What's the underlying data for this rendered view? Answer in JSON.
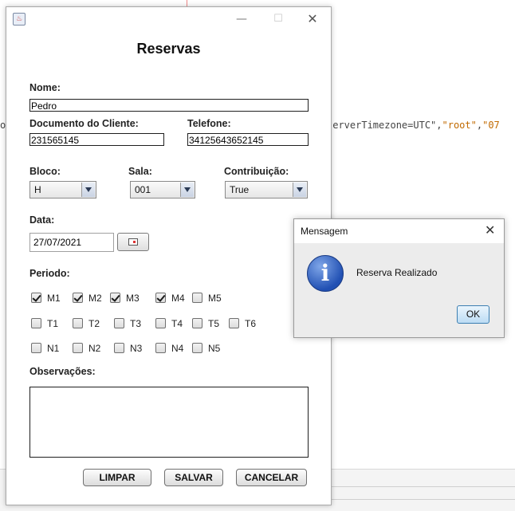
{
  "background": {
    "code_left": "o",
    "code_text_pre": "serverTimezone=UTC\",",
    "code_str1": "\"root\"",
    "code_sep": ",",
    "code_str2": "\"07"
  },
  "window": {
    "title": "",
    "heading": "Reservas",
    "controls": {
      "minimize": "—",
      "maximize": "☐",
      "close": "✕"
    }
  },
  "form": {
    "nome": {
      "label": "Nome:",
      "value": "Pedro"
    },
    "documento": {
      "label": "Documento do Cliente:",
      "value": "231565145"
    },
    "telefone": {
      "label": "Telefone:",
      "value": "34125643652145"
    },
    "bloco": {
      "label": "Bloco:",
      "value": "H"
    },
    "sala": {
      "label": "Sala:",
      "value": "001"
    },
    "contribuicao": {
      "label": "Contribuição:",
      "value": "True"
    },
    "data": {
      "label": "Data:",
      "value": "27/07/2021"
    },
    "periodo": {
      "label": "Periodo:",
      "rows": [
        [
          {
            "label": "M1",
            "checked": true
          },
          {
            "label": "M2",
            "checked": true
          },
          {
            "label": "M3",
            "checked": true
          },
          {
            "label": "M4",
            "checked": true
          },
          {
            "label": "M5",
            "checked": false
          }
        ],
        [
          {
            "label": "T1",
            "checked": false
          },
          {
            "label": "T2",
            "checked": false
          },
          {
            "label": "T3",
            "checked": false
          },
          {
            "label": "T4",
            "checked": false
          },
          {
            "label": "T5",
            "checked": false
          },
          {
            "label": "T6",
            "checked": false
          }
        ],
        [
          {
            "label": "N1",
            "checked": false
          },
          {
            "label": "N2",
            "checked": false
          },
          {
            "label": "N3",
            "checked": false
          },
          {
            "label": "N4",
            "checked": false
          },
          {
            "label": "N5",
            "checked": false
          }
        ]
      ]
    },
    "observacoes": {
      "label": "Observações:",
      "value": ""
    }
  },
  "buttons": {
    "limpar": "LIMPAR",
    "salvar": "SALVAR",
    "cancelar": "CANCELAR"
  },
  "dialog": {
    "title": "Mensagem",
    "message": "Reserva Realizado",
    "ok": "OK",
    "close": "✕",
    "icon": "info-icon"
  }
}
